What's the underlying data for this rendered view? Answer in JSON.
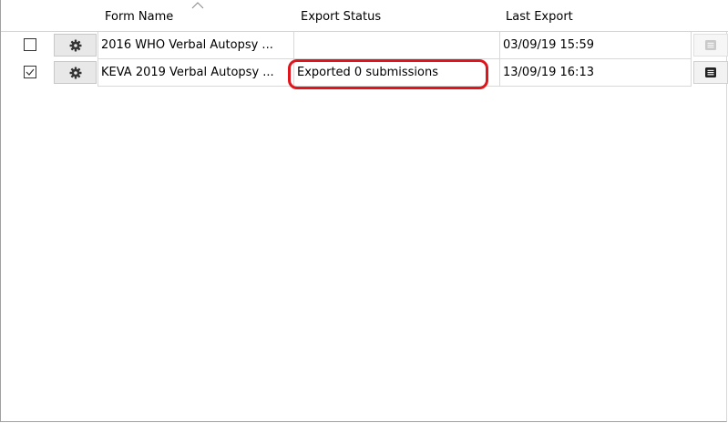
{
  "table": {
    "columns": {
      "form_name": "Form Name",
      "export_status": "Export Status",
      "last_export": "Last Export"
    },
    "sort_column": "Form Name",
    "rows": [
      {
        "checked": false,
        "form_name": "2016 WHO Verbal Autopsy ...",
        "export_status": "",
        "last_export": "03/09/19 15:59",
        "details_enabled": false
      },
      {
        "checked": true,
        "form_name": "KEVA 2019 Verbal Autopsy ...",
        "export_status": "Exported 0 submissions",
        "last_export": "13/09/19 16:13",
        "details_enabled": true
      }
    ]
  },
  "annotation": {
    "color": "#e0151b",
    "target": "Exported 0 submissions"
  }
}
